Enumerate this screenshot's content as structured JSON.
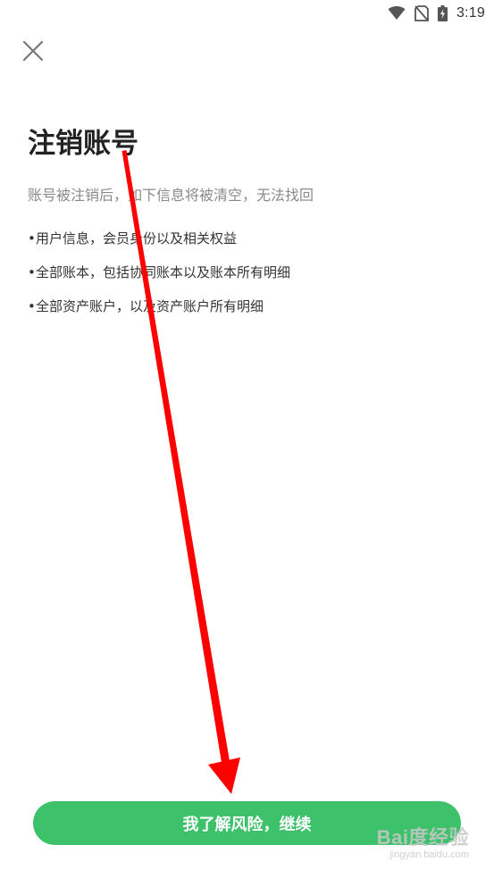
{
  "status_bar": {
    "time": "3:19",
    "icons": [
      "wifi-icon",
      "no-sim-icon",
      "battery-charging-icon"
    ]
  },
  "header": {
    "close_icon": "close-icon"
  },
  "main": {
    "title": "注销账号",
    "subtitle": "账号被注销后，如下信息将被清空，无法找回",
    "bullet_char": "•",
    "items": [
      "用户信息，会员身份以及相关权益",
      "全部账本，包括协同账本以及账本所有明细",
      "全部资产账户，以及资产账户所有明细"
    ]
  },
  "footer": {
    "continue_label": "我了解风险，继续",
    "button_color": "#3dc16a"
  },
  "overlay": {
    "annotation_arrow_color": "#ff0000",
    "watermark_logo": "Bai度经验",
    "watermark_url": "jingyan.baidu.com"
  }
}
